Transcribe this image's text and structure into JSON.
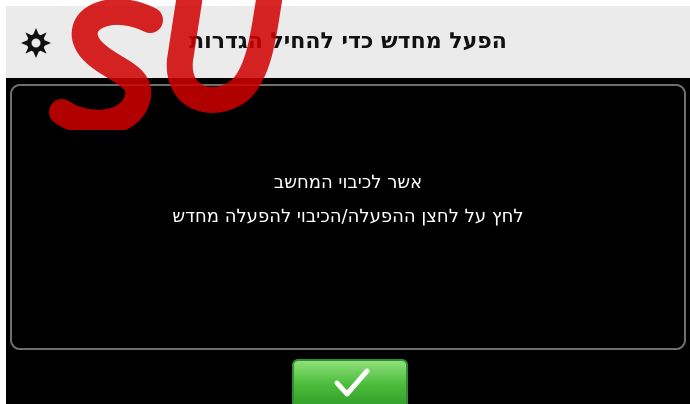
{
  "header": {
    "title": "הפעל מחדש כדי להחיל הגדרות",
    "icon": "gear-icon"
  },
  "dialog": {
    "line1": "אשר לכיבוי המחשב",
    "line2": "לחץ על לחצן ההפעלה/הכיבוי להפעלה מחדש"
  },
  "confirm_button": {
    "icon": "checkmark-icon"
  },
  "colors": {
    "header_bg": "#ebebeb",
    "screen_bg": "#000000",
    "button_green": "#4cbc3c",
    "watermark_red": "#cc0000"
  }
}
